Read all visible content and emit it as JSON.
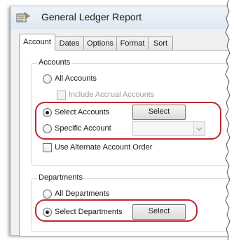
{
  "window": {
    "title": "General Ledger Report",
    "icon": "ledger-icon"
  },
  "tabs": [
    {
      "label": "Account",
      "active": true
    },
    {
      "label": "Dates",
      "active": false
    },
    {
      "label": "Options",
      "active": false
    },
    {
      "label": "Format",
      "active": false
    },
    {
      "label": "Sort",
      "active": false
    }
  ],
  "accounts": {
    "legend": "Accounts",
    "all_accounts": "All Accounts",
    "include_accrual": "Include Accrual Accounts",
    "select_accounts": "Select Accounts",
    "select_button": "Select",
    "specific_account": "Specific Account",
    "specific_value": "",
    "use_alternate_order": "Use Alternate Account Order",
    "selected_option": "Select Accounts"
  },
  "departments": {
    "legend": "Departments",
    "all_departments": "All Departments",
    "select_departments": "Select Departments",
    "select_button": "Select",
    "selected_option": "Select Departments"
  },
  "colors": {
    "highlight": "#c1272d",
    "title_bar": "#dfe8f3",
    "panel": "#ffffff"
  }
}
